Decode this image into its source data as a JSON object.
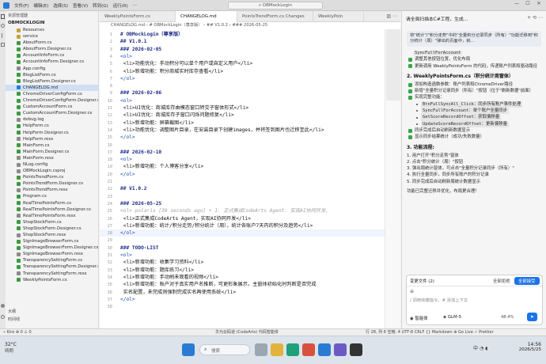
{
  "window": {
    "menu": [
      "文件(F)",
      "编辑(E)",
      "选择(S)",
      "查看(V)",
      "转到(G)",
      "运行(R)",
      "..."
    ],
    "search": "OBMockLogin",
    "controls": [
      "—",
      "☐",
      "✕"
    ]
  },
  "explorer": {
    "header": "资源管理器",
    "project": "OBMOCKLOGIN",
    "items": [
      {
        "label": "Resources",
        "type": "folder"
      },
      {
        "label": "service",
        "type": "folder"
      },
      {
        "label": "AboutForm.cs",
        "type": "cs"
      },
      {
        "label": "AboutForm.Designer.cs",
        "type": "cs"
      },
      {
        "label": "AccountInfoForm.cs",
        "type": "cs"
      },
      {
        "label": "AccountInfoForm.Designer.cs",
        "type": "cs"
      },
      {
        "label": "App.config",
        "type": "file"
      },
      {
        "label": "BlogListForm.cs",
        "type": "cs"
      },
      {
        "label": "BlogListForm.Designer.cs",
        "type": "cs"
      },
      {
        "label": "CHANGELOG.md",
        "type": "md"
      },
      {
        "label": "ChromeDriverConfigForm.cs",
        "type": "cs"
      },
      {
        "label": "ChromeDriverConfigForm.Designer.cs",
        "type": "cs"
      },
      {
        "label": "CustomAccountForm.cs",
        "type": "cs"
      },
      {
        "label": "CustomAccountForm.Designer.cs",
        "type": "cs"
      },
      {
        "label": "debug.log",
        "type": "file"
      },
      {
        "label": "HelpForm.cs",
        "type": "cs"
      },
      {
        "label": "HelpForm.Designer.cs",
        "type": "cs"
      },
      {
        "label": "HelpForm.resx",
        "type": "file"
      },
      {
        "label": "MainForm.cs",
        "type": "cs"
      },
      {
        "label": "MainForm.Designer.cs",
        "type": "cs"
      },
      {
        "label": "MainForm.resx",
        "type": "file"
      },
      {
        "label": "NLog.config",
        "type": "file"
      },
      {
        "label": "OBMockLogin.csproj",
        "type": "file"
      },
      {
        "label": "PointsTrendForm.cs",
        "type": "cs"
      },
      {
        "label": "PointsTrendForm.Designer.cs",
        "type": "cs"
      },
      {
        "label": "PointsTrendForm.resx",
        "type": "file"
      },
      {
        "label": "Program.cs",
        "type": "cs"
      },
      {
        "label": "RealTimePointsForm.cs",
        "type": "cs"
      },
      {
        "label": "RealTimePointsForm.Designer.cs",
        "type": "cs"
      },
      {
        "label": "RealTimePointsForm.resx",
        "type": "file"
      },
      {
        "label": "ShopStockForm.cs",
        "type": "cs"
      },
      {
        "label": "ShopStockForm.Designer.cs",
        "type": "cs"
      },
      {
        "label": "ShopStockForm.resx",
        "type": "file"
      },
      {
        "label": "SignImageBrowserForm.cs",
        "type": "cs"
      },
      {
        "label": "SignImageBrowserForm.Designer.cs",
        "type": "cs"
      },
      {
        "label": "SignImageBrowserForm.resx",
        "type": "file"
      },
      {
        "label": "TransparencySettingForm.cs",
        "type": "cs"
      },
      {
        "label": "TransparencySettingForm.Designer.cs",
        "type": "cs"
      },
      {
        "label": "TransparencySettingForm.resx",
        "type": "file"
      },
      {
        "label": "WeeklyPointsForm.cs",
        "type": "cs"
      }
    ],
    "outline": "大纲",
    "timeline": "时间线"
  },
  "tabs": [
    {
      "label": "WeeklyPointsForm.cs",
      "active": false
    },
    {
      "label": "CHANGELOG.md",
      "active": true
    },
    {
      "label": "PointsTrendForm.cs Changes",
      "active": false
    },
    {
      "label": "WeeklyPoin",
      "active": false
    }
  ],
  "breadcrumb": "CHANGELOG.md › # OBMockLogin（尊享版） › ## V1.0.2 › ### 2026-05-25",
  "editor": {
    "lines": [
      {
        "n": "1",
        "t": "# OBMockLogin（尊享版）",
        "k": "heading"
      },
      {
        "n": "2",
        "t": "## V1.0.1",
        "k": "heading"
      },
      {
        "n": "3",
        "t": "### 2026-02-05",
        "k": "heading"
      },
      {
        "n": "4",
        "t": "<ol>",
        "k": "tag"
      },
      {
        "n": "5",
        "t": "    <li>功能优化：手动积分可以单个用户或自定义用户</li>",
        "k": "code"
      },
      {
        "n": "6",
        "t": "    <li>新增功能：积分商城实时库存查看</li>",
        "k": "code"
      },
      {
        "n": "7",
        "t": "</ol>",
        "k": "tag"
      },
      {
        "n": "8",
        "t": "",
        "k": "code"
      },
      {
        "n": "9",
        "t": "### 2026-02-06",
        "k": "heading"
      },
      {
        "n": "10",
        "t": "<ol>",
        "k": "tag"
      },
      {
        "n": "11",
        "t": "    <li>UI优化：商城库存由模态窗口转交子窗体形式</li>",
        "k": "code"
      },
      {
        "n": "12",
        "t": "    <li>UI优化：商城库存子窗口闪烁问题修复</li>",
        "k": "code"
      },
      {
        "n": "13",
        "t": "    <li>新增功能：屏幕截图</li>",
        "k": "code"
      },
      {
        "n": "14",
        "t": "    <li>功能优化：调整图片目录，在安装目录下创建images，并将签到图片也迁移至此</li>",
        "k": "code"
      },
      {
        "n": "15",
        "t": "</ol>",
        "k": "tag"
      },
      {
        "n": "16",
        "t": "",
        "k": "code"
      },
      {
        "n": "17",
        "t": "### 2026-02-10",
        "k": "heading"
      },
      {
        "n": "18",
        "t": "<ol>",
        "k": "tag"
      },
      {
        "n": "19",
        "t": "    <li>新增功能：个人博客分享</li>",
        "k": "code"
      },
      {
        "n": "20",
        "t": "</ol>",
        "k": "tag"
      },
      {
        "n": "21",
        "t": "",
        "k": "code"
      },
      {
        "n": "22",
        "t": "## V1.0.2",
        "k": "heading"
      },
      {
        "n": "23",
        "t": "",
        "k": "code"
      },
      {
        "n": "24",
        "t": "### 2026-05-25",
        "k": "heading"
      },
      {
        "n": "25",
        "t": "<ol>     polaris [39 seconds ago] • 1. 正式集成CodeArts Agent. 实现AI协同开发。",
        "k": "ghost"
      },
      {
        "n": "26",
        "t": "    <li>正式集成CodeArts Agent，实现AI协同开发</li>",
        "k": "code"
      },
      {
        "n": "27",
        "t": "    <li>新增功能：统计/积分走势/积分统计（周），统计各账户7天内的积分及趋势</li>",
        "k": "code"
      },
      {
        "n": "28",
        "t": "</ol>",
        "k": "tag"
      },
      {
        "n": "29",
        "t": "",
        "k": "code"
      },
      {
        "n": "30",
        "t": "### TODO-LIST",
        "k": "heading"
      },
      {
        "n": "31",
        "t": "<ol>",
        "k": "tag"
      },
      {
        "n": "32",
        "t": "    <li>新增功能：收集学习资料</li>",
        "k": "code"
      },
      {
        "n": "33",
        "t": "    <li>新增功能：题库练习</li>",
        "k": "code"
      },
      {
        "n": "34",
        "t": "    <li>新增功能：手动刷未观看的视频</li>",
        "k": "code"
      },
      {
        "n": "35",
        "t": "    <li>新增功能：账户对于真实用户名推断，可更形象展示，主窗体初始化时判断是否完成",
        "k": "code"
      },
      {
        "n": "36",
        "t": "    实名配置，未完成则强制完成实名再使用系统</li>",
        "k": "code"
      },
      {
        "n": "37",
        "t": "</ol>",
        "k": "tag"
      },
      {
        "n": "38",
        "t": "",
        "k": "code"
      }
    ]
  },
  "chat": {
    "title": "请全面扫描本C#工程，生成...",
    "quote": "将\"统计\"/\"积分走势\"中的\"全量积分记录同步（所有）\"功能迁移到\"积分统计（周）\"弹出的页面中，就...",
    "pre_lines": [
      {
        "kind": "mono-line",
        "text": "SyncFullForAccount"
      },
      {
        "kind": "bullet",
        "text": "调整其他按钮位置，优化布局"
      },
      {
        "kind": "bullet",
        "text": "更新调用 WeeklyPointsForm 的代码，传递账户列表和驱动路径"
      }
    ],
    "section2": "2. WeeklyPointsForm.cs（积分统计周窗体）",
    "sec2_items": [
      {
        "kind": "bullet",
        "text": "添加构造函数参数：账户列表和ChromeDriver路径"
      },
      {
        "kind": "bullet",
        "text": "新增\"全量积分记录同步（所有）\"按钮（位于\"刷新数据\"前面）"
      },
      {
        "kind": "bullet",
        "text": "实现完整功能："
      },
      {
        "kind": "sub",
        "text": "BtnFullSyncAll_Click：同步所有账户事件处理"
      },
      {
        "kind": "sub",
        "text": "SyncFullForAccount：单个账户全量同步"
      },
      {
        "kind": "sub",
        "text": "GetScoreRecordOffset：获取偏移量"
      },
      {
        "kind": "sub",
        "text": "UpdateScoreRecordOffset：更新偏移量"
      },
      {
        "kind": "bullet",
        "text": "同步完成后自动刷新数据显示"
      },
      {
        "kind": "bullet",
        "text": "显示同步结果统计（成功/失败数量）"
      }
    ],
    "section3": "3. 功能流程:",
    "flow": [
      "1. 用户打开\"积分走势\"窗体",
      "2. 点击\"积分统计（周）\"按钮",
      "3. 弹出周统计窗体，可点击\"全量积分记录同步（所有）\"",
      "4. 执行全量同步，同步所有账户的积分记录",
      "5. 同步完成后自动刷新周统计数据显示"
    ],
    "done": "功能已完整迁移并优化，布局更合理！",
    "changes_label": "变更文件 (2)",
    "reject_label": "全部拒绝",
    "accept_label": "全部接受",
    "input_placeholder": "/ 调用快捷指令，# 添加上下文",
    "agent_label": "智能体",
    "model_label": "GLM-5",
    "usage": "48.4%"
  },
  "statusbar": {
    "left": "⑂ Kiro   ⊗ 0 ⚠ 0",
    "center": "华为云码道 (CodeArts) 代码智能体",
    "right": "行 28, 列 6   空格: 4   UTF-8   CRLF   {} Markdown   ⊕ Go Live   ✓ Prettier"
  },
  "taskbar": {
    "weather_temp": "32°C",
    "weather_desc": "晴朗",
    "search_placeholder": "搜索",
    "ime": "中",
    "time": "14:56",
    "date": "2026/5/25"
  },
  "colors": {
    "accent": "#1a73e8",
    "heading": "#1c2a88",
    "tag": "#2348b7"
  }
}
